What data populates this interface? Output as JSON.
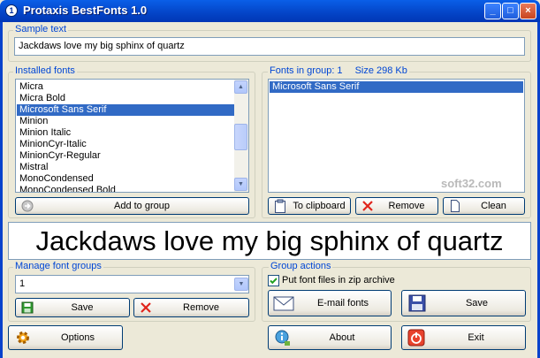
{
  "window": {
    "title": "Protaxis BestFonts 1.0",
    "app_icon": "1",
    "minimize": "_",
    "maximize": "□",
    "close": "×"
  },
  "sample": {
    "legend": "Sample text",
    "value": "Jackdaws love my big sphinx of quartz"
  },
  "installed": {
    "legend": "Installed fonts",
    "items": [
      "Micra",
      "Micra Bold",
      "Microsoft Sans Serif",
      "Minion",
      "Minion Italic",
      "MinionCyr-Italic",
      "MinionCyr-Regular",
      "Mistral",
      "MonoCondensed",
      "MonoCondensed Bold"
    ],
    "selected": "Microsoft Sans Serif",
    "add_label": "Add to group"
  },
  "group": {
    "legend_prefix": "Fonts in group: 1",
    "size_label": "Size 298 Kb",
    "items": [
      "Microsoft Sans Serif"
    ],
    "clipboard_label": "To clipboard",
    "remove_label": "Remove",
    "clean_label": "Clean"
  },
  "preview": {
    "text": "Jackdaws love my big sphinx of quartz"
  },
  "manage": {
    "legend": "Manage font groups",
    "selected": "1",
    "save_label": "Save",
    "remove_label": "Remove"
  },
  "actions": {
    "legend": "Group actions",
    "zip_label": "Put font files in zip archive",
    "zip_checked": true,
    "email_label": "E-mail fonts",
    "save_label": "Save"
  },
  "bottom": {
    "options_label": "Options",
    "about_label": "About",
    "exit_label": "Exit"
  },
  "watermark": "soft32.com"
}
